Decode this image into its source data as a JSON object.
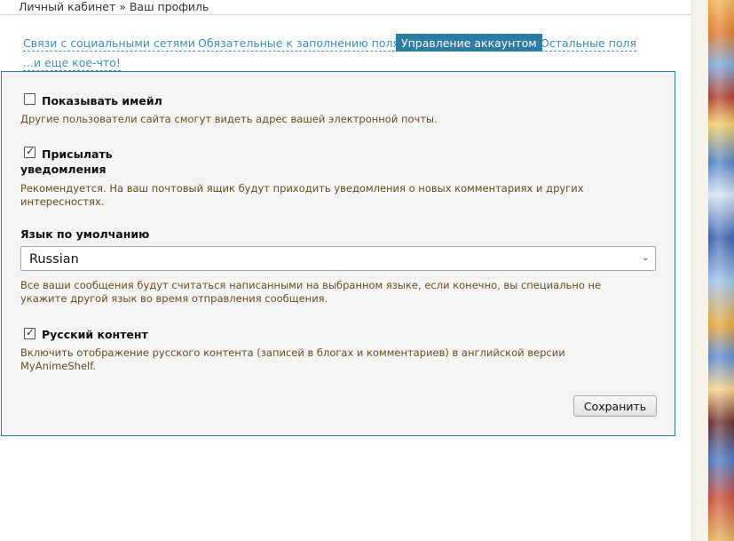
{
  "breadcrumb": {
    "text": "Личный кабинет » Ваш профиль"
  },
  "tabs": [
    {
      "label": "Связи с социальными сетями",
      "active": false
    },
    {
      "label": "Обязательные к заполнению поля",
      "active": false
    },
    {
      "label": "Управление аккаунтом",
      "active": true
    },
    {
      "label": "Остальные поля",
      "active": false
    },
    {
      "label": "...и еще кое-что!",
      "active": false
    }
  ],
  "settings": {
    "show_email": {
      "label": "Показывать имейл",
      "checked": false,
      "help": "Другие пользователи сайта смогут видеть адрес вашей электронной почты."
    },
    "notifications": {
      "label_line1": "Присылать",
      "label_line2": "уведомления",
      "checked": true,
      "help_line1": "Рекомендуется. На ваш почтовый ящик будут приходить уведомления о новых комментариях и других",
      "help_line2": "интересностях."
    },
    "language": {
      "label": "Язык по умолчанию",
      "selected": "Russian",
      "help_line1": "Все ваши сообщения будут считаться написанными на выбранном языке, если конечно, вы специально не",
      "help_line2": "укажите другой язык во время отправления сообщения."
    },
    "russian_content": {
      "label": "Русский контент",
      "checked": true,
      "help_line1": "Включить отображение русского контента (записей в блогах и комментариев) в английской версии",
      "help_line2": "MyAnimeShelf."
    },
    "save_label": "Сохранить"
  },
  "colors": {
    "accent": "#2d7aa3",
    "link": "#3a8fb7",
    "help_text": "#6a4b1f",
    "panel_bg": "#f4f4f4"
  }
}
